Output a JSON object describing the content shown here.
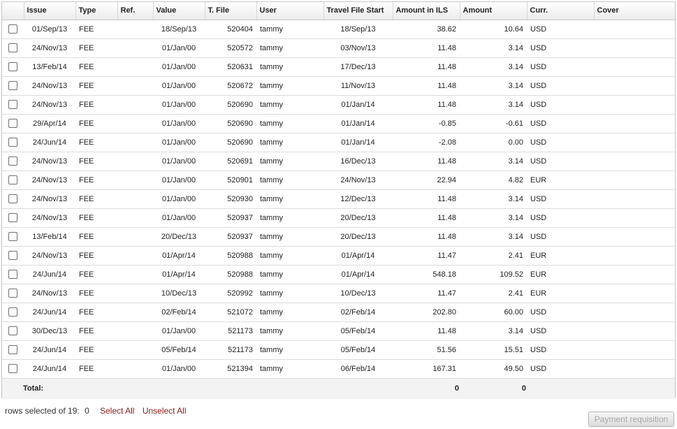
{
  "grid": {
    "headers": [
      "",
      "Issue",
      "Type",
      "Ref.",
      "Value",
      "T. File",
      "User",
      "Travel File Start",
      "Amount in ILS",
      "Amount",
      "Curr.",
      "Cover"
    ],
    "rows": [
      [
        "01/Sep/13",
        "FEE",
        "",
        "18/Sep/13",
        "520404",
        "tammy",
        "18/Sep/13",
        "38.62",
        "10.64",
        "USD",
        ""
      ],
      [
        "24/Nov/13",
        "FEE",
        "",
        "01/Jan/00",
        "520572",
        "tammy",
        "03/Nov/13",
        "11.48",
        "3.14",
        "USD",
        ""
      ],
      [
        "13/Feb/14",
        "FEE",
        "",
        "01/Jan/00",
        "520631",
        "tammy",
        "17/Dec/13",
        "11.48",
        "3.14",
        "USD",
        ""
      ],
      [
        "24/Nov/13",
        "FEE",
        "",
        "01/Jan/00",
        "520672",
        "tammy",
        "11/Nov/13",
        "11.48",
        "3.14",
        "USD",
        ""
      ],
      [
        "24/Nov/13",
        "FEE",
        "",
        "01/Jan/00",
        "520690",
        "tammy",
        "01/Jan/14",
        "11.48",
        "3.14",
        "USD",
        ""
      ],
      [
        "29/Apr/14",
        "FEE",
        "",
        "01/Jan/00",
        "520690",
        "tammy",
        "01/Jan/14",
        "-0.85",
        "-0.61",
        "USD",
        ""
      ],
      [
        "24/Jun/14",
        "FEE",
        "",
        "01/Jan/00",
        "520690",
        "tammy",
        "01/Jan/14",
        "-2.08",
        "0.00",
        "USD",
        ""
      ],
      [
        "24/Nov/13",
        "FEE",
        "",
        "01/Jan/00",
        "520691",
        "tammy",
        "16/Dec/13",
        "11.48",
        "3.14",
        "USD",
        ""
      ],
      [
        "24/Nov/13",
        "FEE",
        "",
        "01/Jan/00",
        "520901",
        "tammy",
        "24/Nov/13",
        "22.94",
        "4.82",
        "EUR",
        ""
      ],
      [
        "24/Nov/13",
        "FEE",
        "",
        "01/Jan/00",
        "520930",
        "tammy",
        "12/Dec/13",
        "11.48",
        "3.14",
        "USD",
        ""
      ],
      [
        "24/Nov/13",
        "FEE",
        "",
        "01/Jan/00",
        "520937",
        "tammy",
        "20/Dec/13",
        "11.48",
        "3.14",
        "USD",
        ""
      ],
      [
        "13/Feb/14",
        "FEE",
        "",
        "20/Dec/13",
        "520937",
        "tammy",
        "20/Dec/13",
        "11.48",
        "3.14",
        "USD",
        ""
      ],
      [
        "24/Nov/13",
        "FEE",
        "",
        "01/Apr/14",
        "520988",
        "tammy",
        "01/Apr/14",
        "11.47",
        "2.41",
        "EUR",
        ""
      ],
      [
        "24/Jun/14",
        "FEE",
        "",
        "01/Apr/14",
        "520988",
        "tammy",
        "01/Apr/14",
        "548.18",
        "109.52",
        "EUR",
        ""
      ],
      [
        "24/Nov/13",
        "FEE",
        "",
        "10/Dec/13",
        "520992",
        "tammy",
        "10/Dec/13",
        "11.47",
        "2.41",
        "EUR",
        ""
      ],
      [
        "24/Jun/14",
        "FEE",
        "",
        "02/Feb/14",
        "521072",
        "tammy",
        "02/Feb/14",
        "202.80",
        "60.00",
        "USD",
        ""
      ],
      [
        "30/Dec/13",
        "FEE",
        "",
        "01/Jan/00",
        "521173",
        "tammy",
        "05/Feb/14",
        "11.48",
        "3.14",
        "USD",
        ""
      ],
      [
        "24/Jun/14",
        "FEE",
        "",
        "05/Feb/14",
        "521173",
        "tammy",
        "05/Feb/14",
        "51.56",
        "15.51",
        "USD",
        ""
      ],
      [
        "24/Jun/14",
        "FEE",
        "",
        "01/Jan/00",
        "521394",
        "tammy",
        "06/Feb/14",
        "167.31",
        "49.50",
        "USD",
        ""
      ]
    ],
    "total": {
      "label": "Total:",
      "amount_ils": "0",
      "amount": "0"
    }
  },
  "footer": {
    "rows_selected_label": "rows selected of 19:",
    "rows_selected_count": "0",
    "select_all": "Select All",
    "unselect_all": "Unselect All",
    "payment_requisition": "Payment requisition"
  },
  "colors": {
    "link": "#8b1a1a",
    "disabled_text": "#a8a8a8"
  }
}
